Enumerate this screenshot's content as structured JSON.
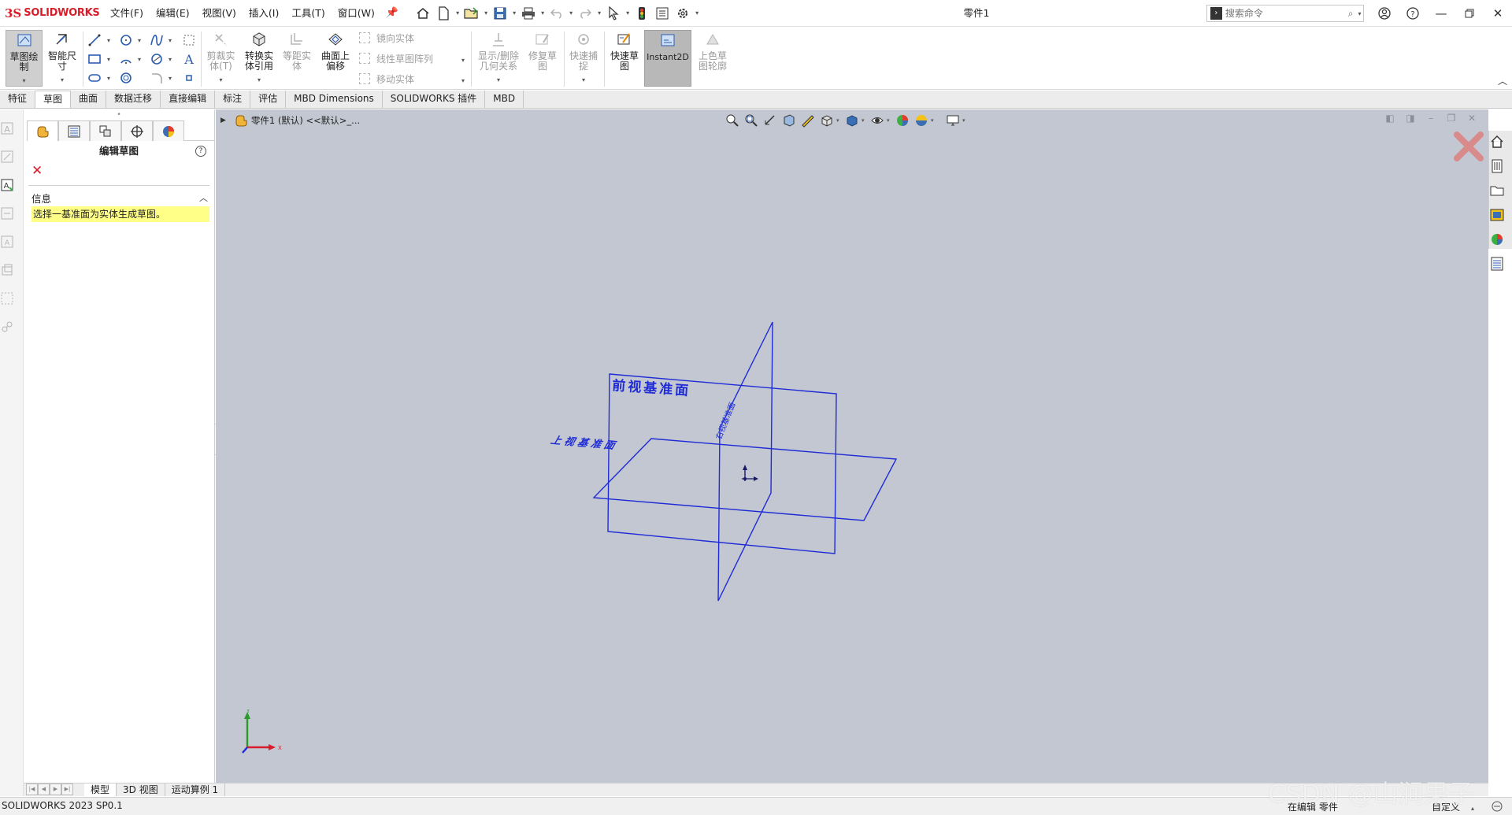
{
  "app": {
    "logo_prefix": "3S",
    "logo_name": "SOLIDWORKS",
    "document_title": "零件1"
  },
  "menu": [
    {
      "label": "文件(F)"
    },
    {
      "label": "编辑(E)"
    },
    {
      "label": "视图(V)"
    },
    {
      "label": "插入(I)"
    },
    {
      "label": "工具(T)"
    },
    {
      "label": "窗口(W)"
    }
  ],
  "search": {
    "placeholder": "搜索命令"
  },
  "ribbon": {
    "sketch_label_1": "草图绘",
    "sketch_label_2": "制",
    "smart_dim_1": "智能尺",
    "smart_dim_2": "寸",
    "trim_1": "剪裁实",
    "trim_2": "体(T)",
    "convert_1": "转换实",
    "convert_2": "体引用",
    "offset_1": "等距实",
    "offset_2": "体",
    "surface_offset_1": "曲面上",
    "surface_offset_2": "偏移",
    "mirror": "镜向实体",
    "linear_pattern": "线性草图阵列",
    "move": "移动实体",
    "show_delete_1": "显示/删除",
    "show_delete_2": "几何关系",
    "repair_1": "修复草",
    "repair_2": "图",
    "quick_snap_1": "快速捕",
    "quick_snap_2": "捉",
    "rapid_sketch_1": "快速草",
    "rapid_sketch_2": "图",
    "instant2d": "Instant2D",
    "shaded_1": "上色草",
    "shaded_2": "图轮廓"
  },
  "tabs": [
    {
      "label": "特征"
    },
    {
      "label": "草图"
    },
    {
      "label": "曲面"
    },
    {
      "label": "数据迁移"
    },
    {
      "label": "直接编辑"
    },
    {
      "label": "标注"
    },
    {
      "label": "评估"
    },
    {
      "label": "MBD Dimensions"
    },
    {
      "label": "SOLIDWORKS 插件"
    },
    {
      "label": "MBD"
    }
  ],
  "property_manager": {
    "title": "编辑草图",
    "help": "?",
    "cancel": "✕",
    "info_header": "信息",
    "info_message": "选择一基准面为实体生成草图。"
  },
  "viewport": {
    "breadcrumb": "零件1  (默认)  <<默认>_...",
    "front_plane": "前视基准面",
    "top_plane": "上视基准面",
    "right_plane": "右视基准面",
    "triad_x": "X",
    "triad_y": "Y"
  },
  "colors": {
    "viewport_bg": "#c2c7d1",
    "plane_stroke": "#1f2bd6",
    "brand_red": "#d81e2a",
    "info_highlight": "#ffff88"
  },
  "bottom_tabs": [
    {
      "label": "模型"
    },
    {
      "label": "3D 视图"
    },
    {
      "label": "运动算例 1"
    }
  ],
  "status": {
    "version": "SOLIDWORKS 2023 SP0.1",
    "editing": "在编辑 零件",
    "custom": "自定义"
  },
  "watermark": "CSDN @山涧果子"
}
